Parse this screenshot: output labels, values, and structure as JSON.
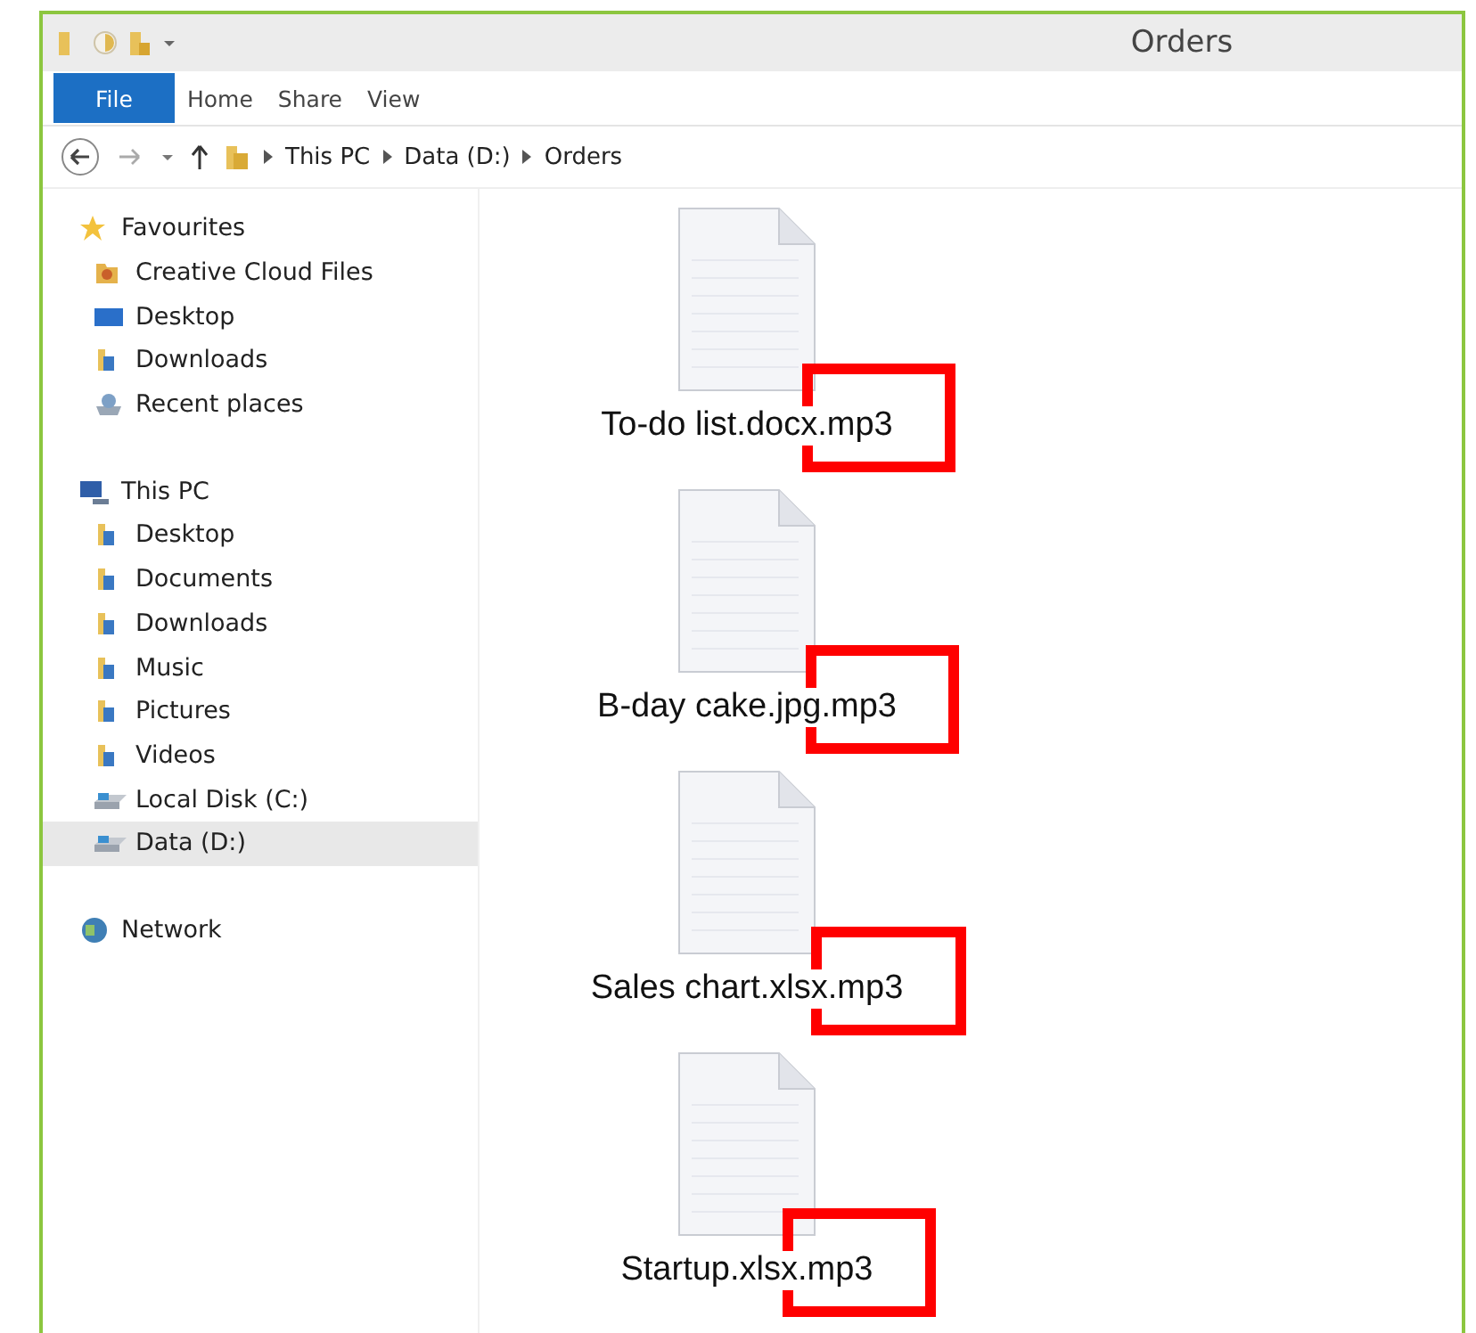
{
  "window": {
    "title": "Orders"
  },
  "ribbon": {
    "tabs": [
      {
        "label": "File",
        "selected": true
      },
      {
        "label": "Home",
        "selected": false
      },
      {
        "label": "Share",
        "selected": false
      },
      {
        "label": "View",
        "selected": false
      }
    ]
  },
  "address_bar": {
    "path": [
      "This PC",
      "Data (D:)",
      "Orders"
    ]
  },
  "sidebar": {
    "groups": [
      {
        "label": "Favourites",
        "kind": "star",
        "selected": false,
        "children": [
          {
            "label": "Creative Cloud Files",
            "kind": "cc",
            "selected": false
          },
          {
            "label": "Desktop",
            "kind": "desktop",
            "selected": false
          },
          {
            "label": "Downloads",
            "kind": "folder",
            "selected": false
          },
          {
            "label": "Recent places",
            "kind": "recent",
            "selected": false
          }
        ]
      },
      {
        "label": "This PC",
        "kind": "computer",
        "selected": false,
        "children": [
          {
            "label": "Desktop",
            "kind": "folder",
            "selected": false
          },
          {
            "label": "Documents",
            "kind": "folder",
            "selected": false
          },
          {
            "label": "Downloads",
            "kind": "folder",
            "selected": false
          },
          {
            "label": "Music",
            "kind": "folder",
            "selected": false
          },
          {
            "label": "Pictures",
            "kind": "folder",
            "selected": false
          },
          {
            "label": "Videos",
            "kind": "folder",
            "selected": false
          },
          {
            "label": "Local Disk (C:)",
            "kind": "drive",
            "selected": false
          },
          {
            "label": "Data (D:)",
            "kind": "drive",
            "selected": true
          }
        ]
      },
      {
        "label": "Network",
        "kind": "network",
        "selected": false
      }
    ]
  },
  "files": [
    {
      "name": "To-do list.docx.mp3",
      "highlighted": true
    },
    {
      "name": "B-day cake.jpg.mp3",
      "highlighted": true
    },
    {
      "name": "Sales chart.xlsx.mp3",
      "highlighted": true
    },
    {
      "name": "Startup.xlsx.mp3",
      "highlighted": true
    }
  ]
}
